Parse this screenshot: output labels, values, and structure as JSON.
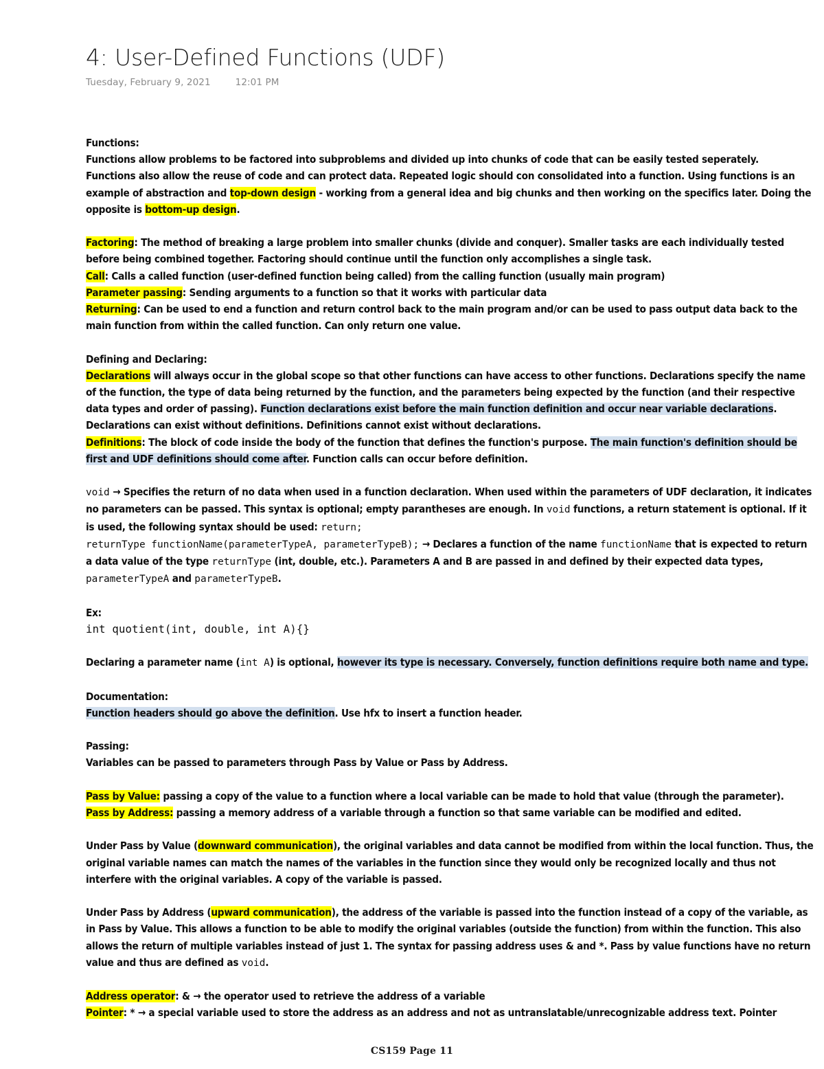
{
  "header": {
    "title": "4: User-Defined Functions (UDF)",
    "date": "Tuesday, February 9, 2021",
    "time": "12:01 PM"
  },
  "colors": {
    "highlight_yellow": "#ffff00",
    "highlight_blue": "#d2dfee",
    "text": "#0d0d0d",
    "meta_text": "#8a8a8a",
    "page_background": "#ffffff"
  },
  "sections": {
    "functions": {
      "heading": "Functions:",
      "line1": "Functions allow problems to be factored into subproblems and divided up into chunks of code that can be easily tested seperately.",
      "line2a": "Functions also allow the reuse of code and can protect data. Repeated logic should con consolidated into a function. Using functions is an example of abstraction and ",
      "hl_top_down": "top-down design",
      "line2b": " - working from a general idea and big chunks and then working on the specifics later. Doing the opposite is ",
      "hl_bottom_up": "bottom-up design",
      "line2c": "."
    },
    "terms": {
      "factoring_term": "Factoring",
      "factoring_def": ": The method of breaking a large problem into smaller chunks (divide and conquer). Smaller tasks are each individually tested before being combined together. Factoring should continue until the function only accomplishes a single task.",
      "call_term": "Call",
      "call_def": ": Calls a called function (user-defined function being called) from the calling function (usually main program)",
      "parameter_passing_term": "Parameter passing",
      "parameter_passing_def": ": Sending arguments to a function so that it works with particular data",
      "returning_term": "Returning",
      "returning_def": ": Can be used to end a function and return control back to the main program and/or can be used to pass output data back to the main function from within the called function. Can only return one value."
    },
    "defining_declaring": {
      "heading": "Defining and Declaring:",
      "declarations_term": "Declarations",
      "declarations_def_a": " will always occur in the global scope so that other functions can have access to other functions. Declarations specify the name of the function, the type of data being returned by the function, and the parameters being expected by the function (and their respective data types and order of passing). ",
      "declarations_hl_blue": "Function declarations exist before the main function definition and occur near variable declarations",
      "declarations_def_b": ". Declarations can exist without definitions. Definitions cannot exist without declarations.",
      "definitions_term": "Definitions",
      "definitions_def_a": ": The block of code inside the body of the function that defines the function's purpose. ",
      "definitions_hl_blue": "The main function's definition should be first and UDF definitions should come after",
      "definitions_def_b": ". Function calls can occur before definition."
    },
    "void_section": {
      "code_void_1": "void",
      "text_a": " → Specifies the return of no data when used in a function declaration. When used within the parameters of UDF declaration, it indicates no parameters can be passed. This syntax is optional; empty parantheses are enough. In ",
      "code_void_2": "void",
      "text_b": " functions, a return statement is optional. If it is used, the following syntax should be used: ",
      "code_return": "return;",
      "signature_code": "returnType functionName(parameterTypeA, parameterTypeB);",
      "signature_text_a": " → Declares a function of the name ",
      "code_functionname": "functionName",
      "signature_text_b": " that is expected to return a data value of the type ",
      "code_returntype": "returnType",
      "signature_text_c": " (int, double, etc.). Parameters A and B are passed in and defined by their expected data types, ",
      "code_paramA": "parameterTypeA",
      "signature_text_d": " and ",
      "code_paramB": "parameterTypeB",
      "signature_text_e": "."
    },
    "example": {
      "heading": "Ex:",
      "code": "int quotient(int, double, int A){}",
      "note_a": "Declaring a parameter name (",
      "note_code": "int A",
      "note_b": ") is optional, ",
      "note_hl_blue": "however its type is necessary. Conversely, function definitions require both name and type.",
      "note_c": ""
    },
    "documentation": {
      "heading": "Documentation:",
      "hl_blue": "Function headers should go above the definition",
      "text": ". Use hfx to insert a function header."
    },
    "passing": {
      "heading": "Passing:",
      "intro": "Variables can be passed to parameters through Pass by Value or Pass by Address.",
      "pass_by_value_term": "Pass by Value:",
      "pass_by_value_def": " passing a copy of the value to a function where a local variable can be made to hold that value (through the parameter).",
      "pass_by_address_term": "Pass by Address:",
      "pass_by_address_def": " passing a memory address of a variable through a function so that same variable can be modified and edited."
    },
    "downward": {
      "text_a": "Under Pass by Value (",
      "hl_yellow": "downward communication",
      "text_b": "), the original variables and data cannot be modified from within the local function. Thus, the original variable names can match the names of the variables in the function since they would only be recognized locally and thus not interfere with the original variables. A copy of the variable is passed."
    },
    "upward": {
      "text_a": "Under Pass by Address (",
      "hl_yellow": "upward communication",
      "text_b": "), the address of the variable is passed into the function instead of a copy of the variable, as in Pass by Value. This allows a function to be able to modify the original variables (outside the function) from within the function. This also allows the return of multiple variables instead of just 1. The syntax for passing address uses & and *. Pass by value functions have no return value and thus are defined as ",
      "code_void": "void",
      "text_c": "."
    },
    "operators": {
      "address_operator_term": "Address operator",
      "address_operator_def": ": &  → the operator used to retrieve the address of a variable",
      "pointer_term": "Pointer",
      "pointer_def": ": *  → a special variable used to store the address as an address and not as untranslatable/unrecognizable address text. Pointer"
    }
  },
  "footer": {
    "text": "CS159 Page 11"
  }
}
